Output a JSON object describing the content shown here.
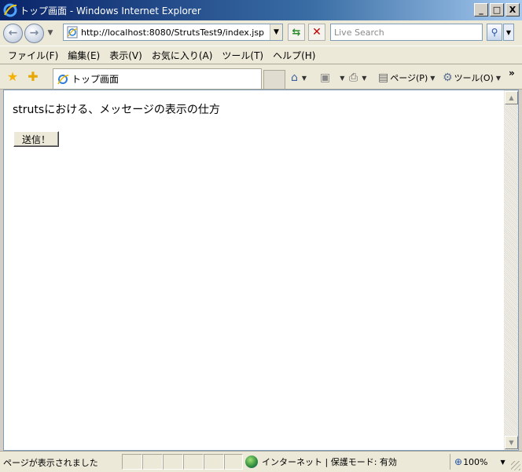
{
  "window": {
    "title": "トップ画面 - Windows Internet Explorer",
    "minimize": "_",
    "maximize": "□",
    "close": "X"
  },
  "nav": {
    "back": "←",
    "forward": "→",
    "address": "http://localhost:8080/StrutsTest9/index.jsp",
    "search_placeholder": "Live Search"
  },
  "menu": {
    "items": [
      "ファイル(F)",
      "編集(E)",
      "表示(V)",
      "お気に入り(A)",
      "ツール(T)",
      "ヘルプ(H)"
    ]
  },
  "favbar": {
    "tab_title": "トップ画面"
  },
  "commands": {
    "page": "ページ(P)",
    "tools": "ツール(O)"
  },
  "content": {
    "heading": "strutsにおける、メッセージの表示の仕方",
    "button": "送信！"
  },
  "status": {
    "text": "ページが表示されました",
    "zone": "インターネット | 保護モード: 有効",
    "zoom": "100%"
  },
  "icons": [
    "ie-logo-icon",
    "back-icon",
    "forward-icon",
    "page-icon",
    "refresh-icon",
    "stop-icon",
    "search-icon",
    "favorites-star-icon",
    "add-favorites-icon",
    "home-icon",
    "feeds-icon",
    "print-icon",
    "page-menu-icon",
    "tools-gear-icon",
    "globe-icon",
    "zoom-icon"
  ]
}
